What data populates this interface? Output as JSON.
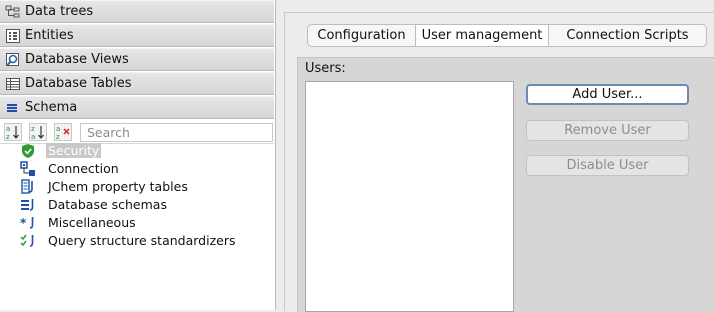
{
  "sidebar": {
    "sections": [
      {
        "label": "Data trees",
        "icon": "data-trees-icon"
      },
      {
        "label": "Entities",
        "icon": "entities-icon"
      },
      {
        "label": "Database Views",
        "icon": "database-views-icon"
      },
      {
        "label": "Database Tables",
        "icon": "database-tables-icon"
      },
      {
        "label": "Schema",
        "icon": "schema-icon"
      }
    ],
    "search": {
      "placeholder": "Search"
    },
    "tree": [
      {
        "label": "Security",
        "icon": "shield-icon",
        "selected": true
      },
      {
        "label": "Connection",
        "icon": "connection-icon"
      },
      {
        "label": "JChem property tables",
        "icon": "jchem-table-icon"
      },
      {
        "label": "Database schemas",
        "icon": "database-schema-icon"
      },
      {
        "label": "Miscellaneous",
        "icon": "miscellaneous-icon"
      },
      {
        "label": "Query structure standardizers",
        "icon": "standardizer-icon"
      }
    ]
  },
  "tabs": [
    {
      "label": "Configuration",
      "active": false
    },
    {
      "label": "User management",
      "active": true
    },
    {
      "label": "Connection Scripts",
      "active": false
    }
  ],
  "users_panel": {
    "label": "Users:",
    "buttons": {
      "add": "Add User...",
      "remove": "Remove User",
      "disable": "Disable User"
    }
  },
  "colors": {
    "selection": "#c8c8c8",
    "focus_border": "#6b8bb4",
    "icon_blue": "#1f4fa8",
    "icon_green": "#2e9a36"
  }
}
